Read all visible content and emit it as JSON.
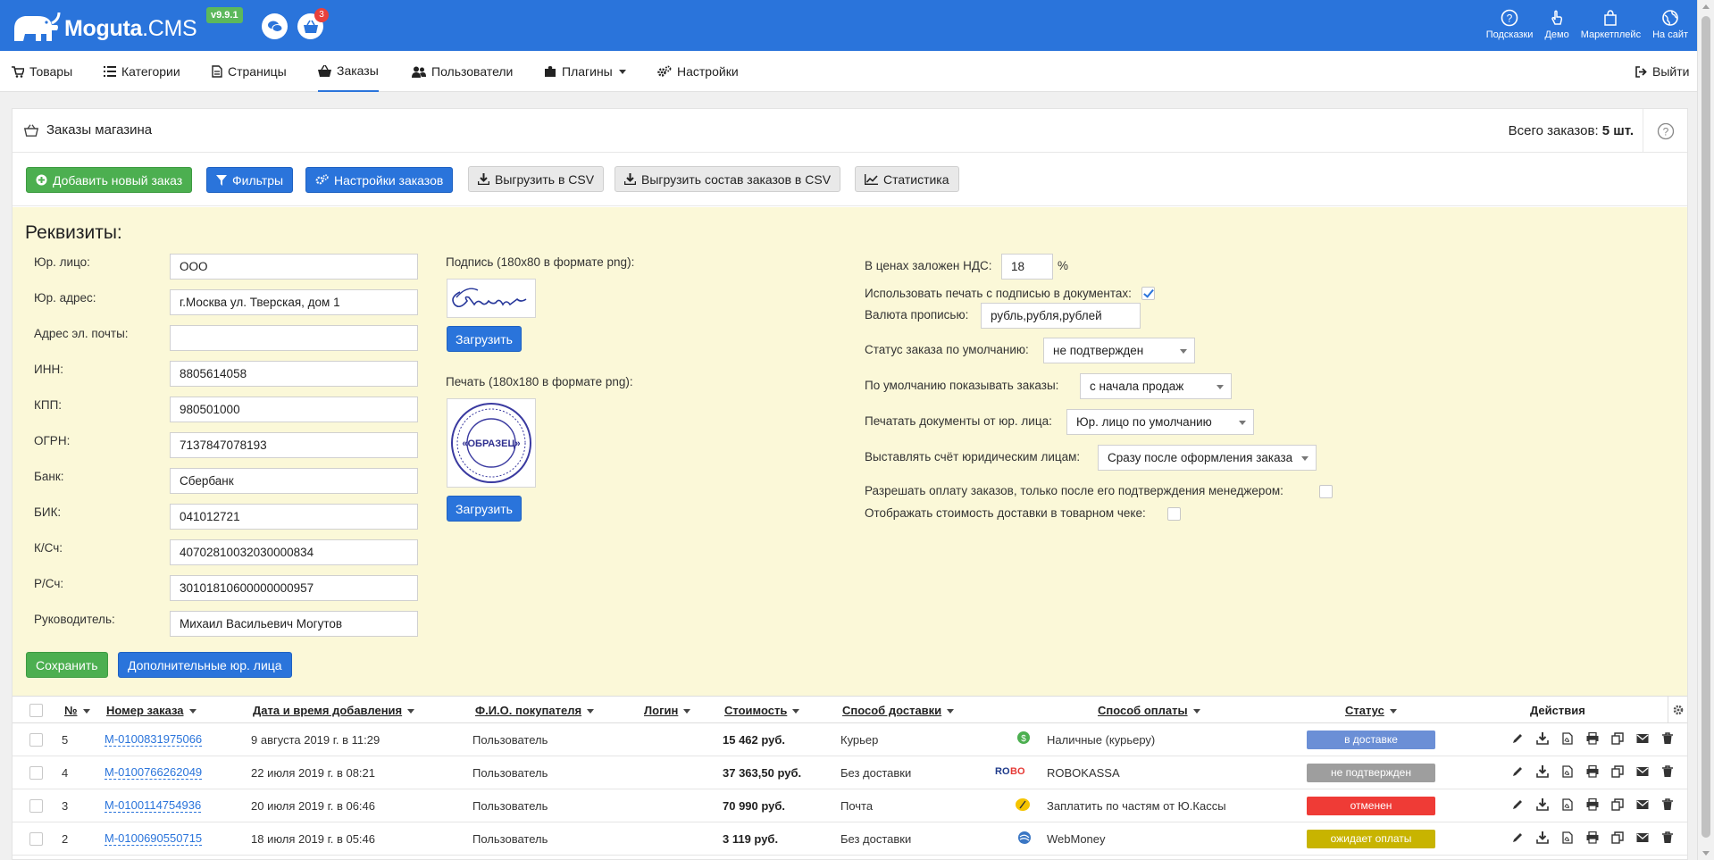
{
  "header": {
    "logo_text_bold": "Moguta",
    "logo_text_rest": ".CMS",
    "version": "v9.9.1",
    "cart_badge": "3",
    "links": [
      {
        "label": "Подсказки",
        "icon": "question-icon"
      },
      {
        "label": "Демо",
        "icon": "hand-pointer-icon"
      },
      {
        "label": "Маркетплейс",
        "icon": "shopping-bag-icon"
      },
      {
        "label": "На сайт",
        "icon": "globe-icon"
      }
    ]
  },
  "nav": {
    "items": [
      {
        "label": "Товары",
        "icon": "cart-icon"
      },
      {
        "label": "Категории",
        "icon": "list-icon"
      },
      {
        "label": "Страницы",
        "icon": "page-icon"
      },
      {
        "label": "Заказы",
        "icon": "basket-icon",
        "active": true
      },
      {
        "label": "Пользователи",
        "icon": "users-icon"
      },
      {
        "label": "Плагины",
        "icon": "puzzle-icon"
      },
      {
        "label": "Настройки",
        "icon": "cogs-icon"
      }
    ],
    "logout": "Выйти"
  },
  "panel": {
    "title": "Заказы магазина",
    "total_prefix": "Всего заказов: ",
    "total_value": "5 шт."
  },
  "toolbar": {
    "add_order": "Добавить новый заказ",
    "filters": "Фильтры",
    "order_settings": "Настройки заказов",
    "export_csv": "Выгрузить в CSV",
    "export_composition_csv": "Выгрузить состав заказов в CSV",
    "statistics": "Статистика"
  },
  "requisites": {
    "title": "Реквизиты:",
    "fields": [
      {
        "label": "Юр. лицо:",
        "value": "ООО"
      },
      {
        "label": "Юр. адрес:",
        "value": "г.Москва ул. Тверская, дом 1"
      },
      {
        "label": "Адрес эл. почты:",
        "value": ""
      },
      {
        "label": "ИНН:",
        "value": "8805614058"
      },
      {
        "label": "КПП:",
        "value": "980501000"
      },
      {
        "label": "ОГРН:",
        "value": "7137847078193"
      },
      {
        "label": "Банк:",
        "value": "Сбербанк"
      },
      {
        "label": "БИК:",
        "value": "041012721"
      },
      {
        "label": "К/Сч:",
        "value": "40702810032030000834"
      },
      {
        "label": "Р/Сч:",
        "value": "30101810600000000957"
      },
      {
        "label": "Руководитель:",
        "value": "Михаил Васильевич Могутов"
      }
    ],
    "signature_label": "Подпись (180x80 в формате png):",
    "stamp_label": "Печать (180x180 в формате png):",
    "stamp_text": "«ОБРАЗЕЦ»",
    "upload": "Загрузить",
    "save": "Сохранить",
    "extra_entities": "Дополнительные юр. лица",
    "vat_label": "В ценах заложен НДС:",
    "vat_value": "18",
    "vat_unit": "%",
    "use_stamp_label": "Использовать печать с подписью в документах:",
    "use_stamp_checked": true,
    "currency_label": "Валюта прописью:",
    "currency_value": "рубль,рубля,рублей",
    "default_status_label": "Статус заказа по умолчанию:",
    "default_status_value": "не подтвержден",
    "show_orders_label": "По умолчанию показывать заказы:",
    "show_orders_value": "с начала продаж",
    "print_docs_label": "Печатать документы от юр. лица:",
    "print_docs_value": "Юр. лицо по умолчанию",
    "invoice_label": "Выставлять счёт юридическим лицам:",
    "invoice_value": "Сразу после оформления заказа",
    "allow_pay_label": "Разрешать оплату заказов, только после его подтверждения менеджером:",
    "allow_pay_checked": false,
    "show_delivery_label": "Отображать стоимость доставки в товарном чеке:",
    "show_delivery_checked": false
  },
  "table": {
    "headers": {
      "num": "№",
      "order_number": "Номер заказа",
      "date": "Дата и время добавления",
      "buyer": "Ф.И.О. покупателя",
      "login": "Логин",
      "cost": "Стоимость",
      "delivery": "Способ доставки",
      "payment": "Способ оплаты",
      "status": "Статус",
      "actions": "Действия"
    },
    "rows": [
      {
        "num": "5",
        "order": "M-0100831975066",
        "date": "9 августа 2019 г. в 11:29",
        "buyer": "Пользователь",
        "cost": "15 462 руб.",
        "delivery": "Курьер",
        "payment": "Наличные (курьеру)",
        "pay_icon": "cash-icon",
        "status": "в доставке",
        "status_color": "#6b8fd6"
      },
      {
        "num": "4",
        "order": "M-0100766262049",
        "date": "22 июля 2019 г. в 08:21",
        "buyer": "Пользователь",
        "cost": "37 363,50 руб.",
        "delivery": "Без доставки",
        "payment": "ROBOKASSA",
        "pay_icon": "robokassa-icon",
        "status": "не подтвержден",
        "status_color": "#9e9e9e"
      },
      {
        "num": "3",
        "order": "M-0100114754936",
        "date": "20 июля 2019 г. в 06:46",
        "buyer": "Пользователь",
        "cost": "70 990 руб.",
        "delivery": "Почта",
        "payment": "Заплатить по частям от Ю.Кассы",
        "pay_icon": "yookassa-icon",
        "status": "отменен",
        "status_color": "#ef3b36"
      },
      {
        "num": "2",
        "order": "M-0100690550715",
        "date": "18 июля 2019 г. в 05:46",
        "buyer": "Пользователь",
        "cost": "3 119 руб.",
        "delivery": "Без доставки",
        "payment": "WebMoney",
        "pay_icon": "webmoney-icon",
        "status": "ожидает оплаты",
        "status_color": "#c8b400"
      }
    ]
  },
  "colors": {
    "brand": "#2a74db",
    "green": "#4caf50",
    "form_bg": "#fbf8d8"
  }
}
